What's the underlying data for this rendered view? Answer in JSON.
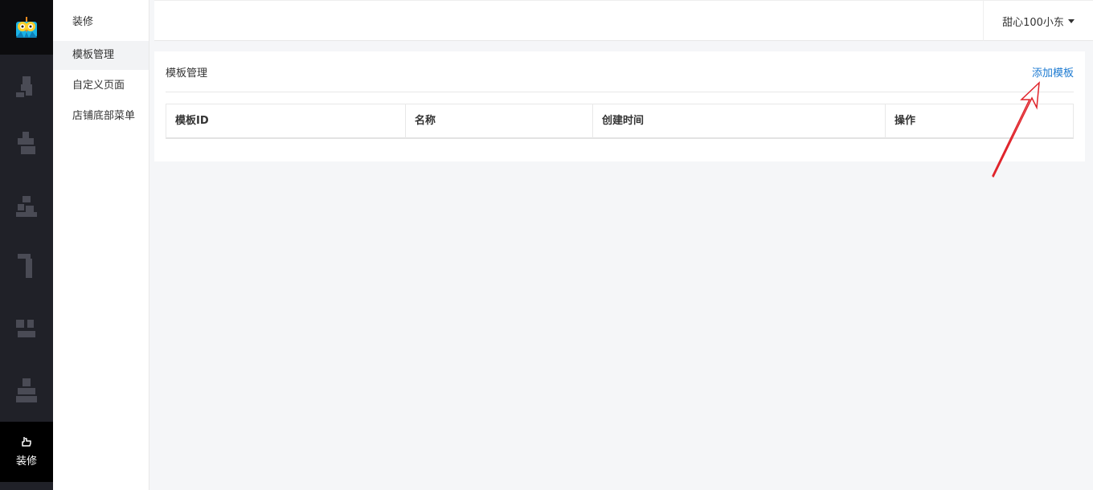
{
  "rail": {
    "active_label": "装修"
  },
  "sidebar": {
    "title": "装修",
    "items": [
      {
        "label": "模板管理",
        "active": true
      },
      {
        "label": "自定义页面",
        "active": false
      },
      {
        "label": "店铺底部菜单",
        "active": false
      }
    ]
  },
  "topbar": {
    "user_name": "甜心100小东"
  },
  "panel": {
    "title": "模板管理",
    "add_link": "添加模板",
    "table": {
      "columns": [
        "模板ID",
        "名称",
        "创建时间",
        "操作"
      ]
    }
  },
  "colors": {
    "rail_bg": "#202128",
    "link": "#1c7ad1",
    "annotation_arrow": "#e0242b"
  }
}
